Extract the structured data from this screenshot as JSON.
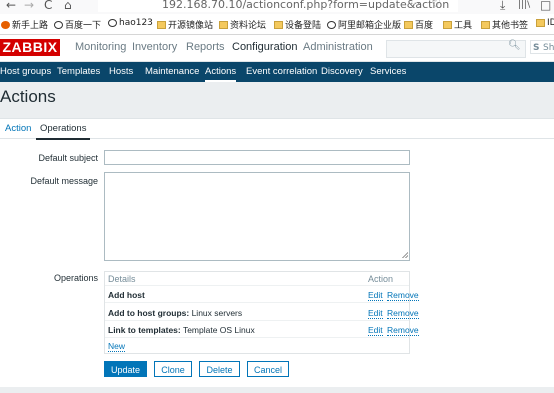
{
  "browser": {
    "back": "←",
    "forward": "→",
    "reload": "C",
    "home": "⌂",
    "url": "192.168.70.10/actionconf.php?form=update&action",
    "menu_dots": "···",
    "pocket": "♡",
    "download": "⤓",
    "library": "|||\\",
    "sidebar": "□"
  },
  "bookmarks": [
    {
      "label": "新手上路",
      "icon": "firefox-icon"
    },
    {
      "label": "百度一下",
      "icon": "globe-icon"
    },
    {
      "label": "hao123",
      "icon": "globe-icon"
    },
    {
      "label": "开源镜像站",
      "icon": "folder-icon"
    },
    {
      "label": "资料论坛",
      "icon": "folder-icon"
    },
    {
      "label": "设备登陆",
      "icon": "folder-icon"
    },
    {
      "label": "阿里邮箱企业版",
      "icon": "globe-icon"
    },
    {
      "label": "百度",
      "icon": "folder-icon"
    },
    {
      "label": "工具",
      "icon": "folder-icon"
    },
    {
      "label": "其他书签",
      "icon": "folder-icon"
    },
    {
      "label": "ID",
      "icon": "folder-icon"
    }
  ],
  "header": {
    "logo": "ZABBIX",
    "menu": [
      "Monitoring",
      "Inventory",
      "Reports",
      "Configuration",
      "Administration"
    ],
    "active_menu": "Configuration",
    "search_placeholder": "",
    "search_icon": "search-icon",
    "share_label": "Shar"
  },
  "subnav": {
    "items": [
      "Host groups",
      "Templates",
      "Hosts",
      "Maintenance",
      "Actions",
      "Event correlation",
      "Discovery",
      "Services"
    ],
    "active": "Actions"
  },
  "page": {
    "title": "Actions"
  },
  "tabs": {
    "action": "Action",
    "operations": "Operations",
    "selected": "Operations"
  },
  "form": {
    "default_subject_label": "Default subject",
    "default_subject_value": "",
    "default_message_label": "Default message",
    "default_message_value": "",
    "operations_label": "Operations"
  },
  "operations": {
    "header_details": "Details",
    "header_action": "Action",
    "rows": [
      {
        "bold": "Add host",
        "rest": "",
        "edit": "Edit",
        "remove": "Remove"
      },
      {
        "bold": "Add to host groups:",
        "rest": " Linux servers",
        "edit": "Edit",
        "remove": "Remove"
      },
      {
        "bold": "Link to templates:",
        "rest": " Template OS Linux",
        "edit": "Edit",
        "remove": "Remove"
      }
    ],
    "new_link": "New"
  },
  "buttons": {
    "update": "Update",
    "clone": "Clone",
    "delete": "Delete",
    "cancel": "Cancel"
  },
  "colors": {
    "brand_red": "#d40000",
    "subnav_bg": "#0a466a",
    "link_blue": "#0275b8"
  }
}
